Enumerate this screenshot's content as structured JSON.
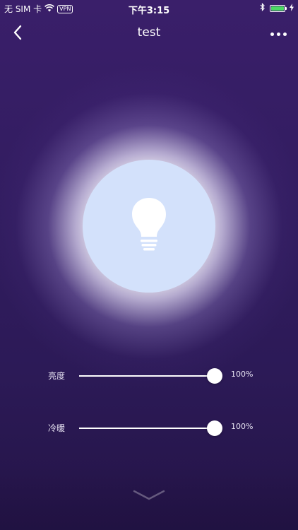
{
  "status_bar": {
    "carrier": "无 SIM 卡",
    "vpn": "VPN",
    "time": "下午3:15",
    "wifi_icon": "wifi-icon",
    "bluetooth_icon": "bluetooth-icon",
    "battery_icon": "battery-icon",
    "charging_icon": "charging-bolt-icon",
    "battery_level": 1.0,
    "battery_color": "#4cd964"
  },
  "nav": {
    "title": "test",
    "back_icon": "chevron-left-icon",
    "more_icon": "more-horizontal-icon"
  },
  "bulb": {
    "icon": "lightbulb-icon",
    "disc_color": "#d3e1fb"
  },
  "sliders": [
    {
      "label": "亮度",
      "value_text": "100%",
      "value": 1.0
    },
    {
      "label": "冷暖",
      "value_text": "100%",
      "value": 1.0
    }
  ],
  "bottom": {
    "expand_icon": "chevron-down-icon"
  },
  "colors": {
    "background": "#311c5f",
    "text": "#ffffff"
  }
}
